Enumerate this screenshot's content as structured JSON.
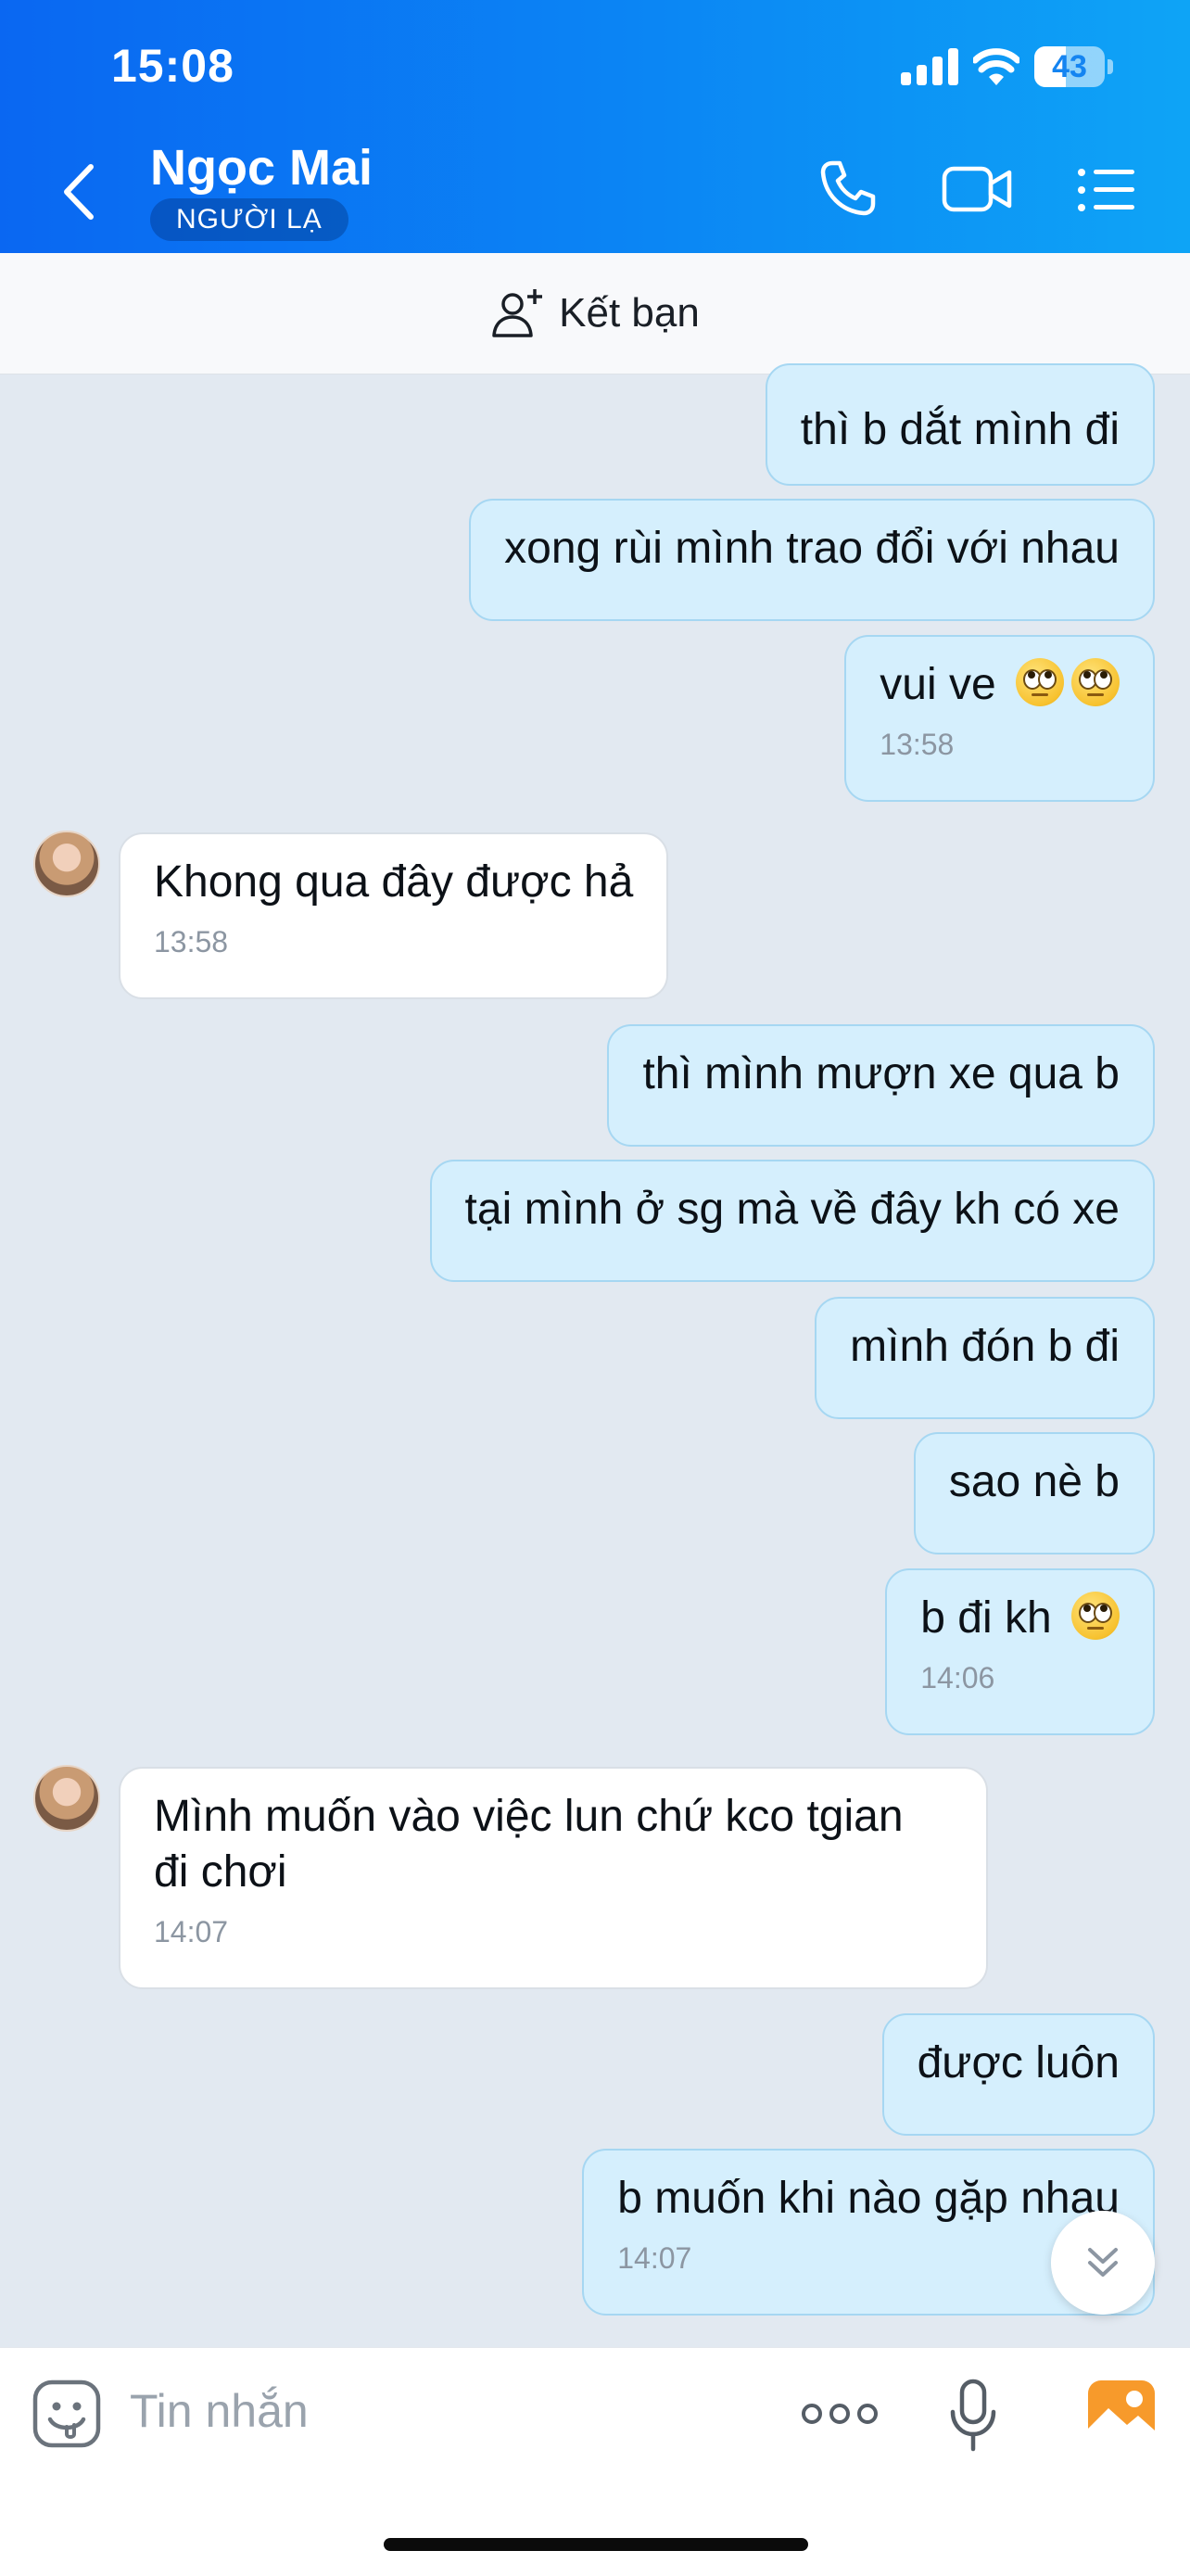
{
  "status_bar": {
    "time": "15:08",
    "battery": "43"
  },
  "header": {
    "name": "Ngọc Mai",
    "badge": "NGƯỜI LẠ"
  },
  "friend_bar": {
    "label": "Kết bạn"
  },
  "messages": [
    {
      "side": "out",
      "text": "thì b dắt mình đi"
    },
    {
      "side": "out",
      "text": "xong rùi mình trao đổi với nhau"
    },
    {
      "side": "out",
      "text": "vui ve",
      "emoji": "eye-roll-emoji x2",
      "time": "13:58"
    },
    {
      "side": "in",
      "text": "Khong qua đây được hả",
      "time": "13:58"
    },
    {
      "side": "out",
      "text": "thì mình mượn xe qua b"
    },
    {
      "side": "out",
      "text": "tại mình ở sg mà về đây kh có xe"
    },
    {
      "side": "out",
      "text": "mình đón b đi"
    },
    {
      "side": "out",
      "text": "sao nè b"
    },
    {
      "side": "out",
      "text": "b đi kh",
      "emoji": "eye-roll-emoji",
      "time": "14:06"
    },
    {
      "side": "in",
      "text": "Mình muốn vào việc lun chứ kco tgian",
      "text2": "đi chơi",
      "time": "14:07"
    },
    {
      "side": "out",
      "text": "được luôn"
    },
    {
      "side": "out",
      "text": "b muốn khi nào gặp nhau",
      "time": "14:07"
    }
  ],
  "input": {
    "placeholder": "Tin nhắn"
  },
  "colors": {
    "header_start": "#0a67f2",
    "header_end": "#0ea4f6",
    "outgoing_bubble": "#d5effd",
    "incoming_bubble": "#ffffff",
    "chat_bg": "#e2e9f1"
  }
}
